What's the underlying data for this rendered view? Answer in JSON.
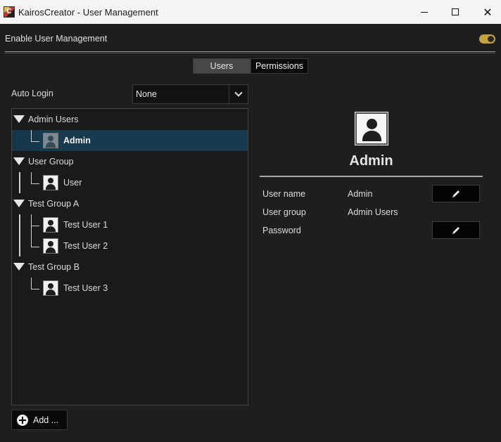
{
  "window": {
    "title": "KairosCreator - User Management",
    "icon_letter": "C"
  },
  "enable": {
    "label": "Enable User Management",
    "enabled": true
  },
  "tabs": [
    {
      "label": "Users",
      "active": true
    },
    {
      "label": "Permissions",
      "active": false
    }
  ],
  "auto_login": {
    "label": "Auto Login",
    "value": "None"
  },
  "tree": {
    "groups": [
      {
        "label": "Admin Users",
        "users": [
          {
            "label": "Admin",
            "selected": true
          }
        ]
      },
      {
        "label": "User Group",
        "users": [
          {
            "label": "User",
            "selected": false
          }
        ]
      },
      {
        "label": "Test Group A",
        "users": [
          {
            "label": "Test User 1",
            "selected": false
          },
          {
            "label": "Test User 2",
            "selected": false
          }
        ]
      },
      {
        "label": "Test Group B",
        "users": [
          {
            "label": "Test User 3",
            "selected": false
          }
        ]
      }
    ]
  },
  "add_button": {
    "label": "Add ..."
  },
  "detail": {
    "name": "Admin",
    "fields": {
      "username_label": "User name",
      "username_value": "Admin",
      "usergroup_label": "User group",
      "usergroup_value": "Admin Users",
      "password_label": "Password"
    }
  },
  "colors": {
    "background": "#1e1e1e",
    "toggle_on": "#c8a23a",
    "selection": "#173a4f",
    "active_tab": "#474747"
  }
}
